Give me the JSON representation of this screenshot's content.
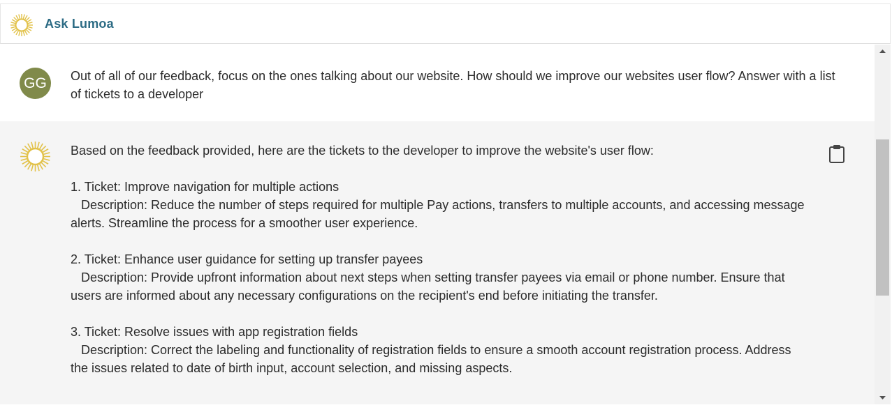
{
  "header": {
    "title": "Ask Lumoa",
    "logo_icon": "sun-icon"
  },
  "colors": {
    "brand_title": "#2c6b84",
    "avatar_bg": "#808a4a",
    "sun": "#e2c24a",
    "bot_bg": "#f5f5f5"
  },
  "conversation": {
    "user": {
      "initials": "GG",
      "text": "Out of all of our feedback, focus on the ones talking about our website. How should we improve our websites user flow? Answer with a list of tickets to a developer"
    },
    "assistant": {
      "avatar_icon": "sun-icon",
      "copy_icon": "clipboard-icon",
      "text": "Based on the feedback provided, here are the tickets to the developer to improve the website's user flow:\n\n1. Ticket: Improve navigation for multiple actions\n   Description: Reduce the number of steps required for multiple Pay actions, transfers to multiple accounts, and accessing message alerts. Streamline the process for a smoother user experience.\n\n2. Ticket: Enhance user guidance for setting up transfer payees\n   Description: Provide upfront information about next steps when setting transfer payees via email or phone number. Ensure that users are informed about any necessary configurations on the recipient's end before initiating the transfer.\n\n3. Ticket: Resolve issues with app registration fields\n   Description: Correct the labeling and functionality of registration fields to ensure a smooth account registration process. Address the issues related to date of birth input, account selection, and missing aspects."
    }
  }
}
